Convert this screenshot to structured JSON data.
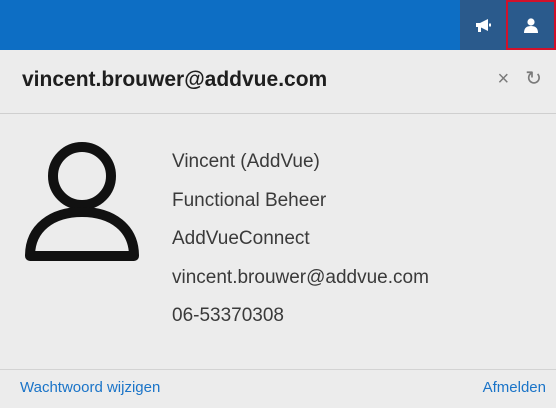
{
  "topbar": {
    "accent": "#0d6ec4",
    "buttons": [
      {
        "icon": "megaphone-icon"
      },
      {
        "icon": "user-icon",
        "highlight": "#d0112b"
      }
    ]
  },
  "panel": {
    "title": "vincent.brouwer@addvue.com",
    "close_icon": "×",
    "refresh_icon": "↻",
    "avatar_icon": "user-outline-icon",
    "info": {
      "name": "Vincent (AddVue)",
      "role": "Functional Beheer",
      "company": "AddVueConnect",
      "email": "vincent.brouwer@addvue.com",
      "phone": "06-53370308"
    },
    "footer": {
      "change_password": "Wachtwoord wijzigen",
      "logout": "Afmelden"
    }
  }
}
